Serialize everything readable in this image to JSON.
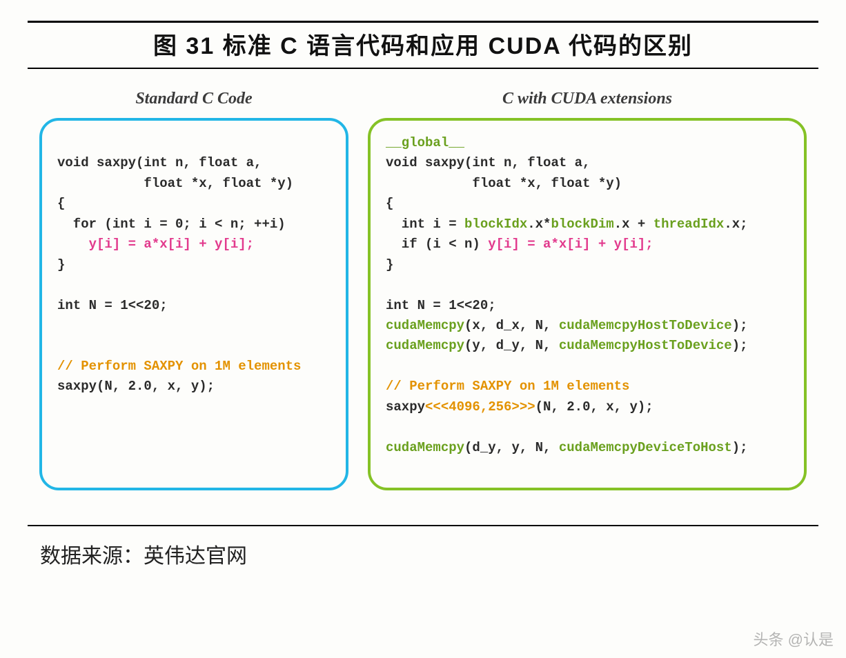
{
  "title": "图 31 标准 C 语言代码和应用 CUDA 代码的区别",
  "left": {
    "heading": "Standard C Code",
    "code": [
      {
        "text": "",
        "cls": ""
      },
      {
        "text": "void saxpy(int n, float a,",
        "cls": "tok-black"
      },
      {
        "text": "           float *x, float *y)",
        "cls": "tok-black"
      },
      {
        "text": "{",
        "cls": "tok-black"
      },
      {
        "text": "  for (int i = 0; i < n; ++i)",
        "cls": "tok-black"
      },
      {
        "text": "    y[i] = a*x[i] + y[i];",
        "cls": "tok-pink"
      },
      {
        "text": "}",
        "cls": "tok-black"
      },
      {
        "text": "",
        "cls": ""
      },
      {
        "text": "int N = 1<<20;",
        "cls": "tok-black"
      },
      {
        "text": "",
        "cls": ""
      },
      {
        "text": "",
        "cls": ""
      },
      {
        "text": "// Perform SAXPY on 1M elements",
        "cls": "tok-comment"
      },
      {
        "text": "saxpy(N, 2.0, x, y);",
        "cls": "tok-black"
      }
    ]
  },
  "right": {
    "heading": "C with CUDA extensions",
    "code": [
      {
        "segments": [
          {
            "text": "__global__",
            "cls": "tok-green"
          }
        ]
      },
      {
        "segments": [
          {
            "text": "void saxpy(int n, float a,",
            "cls": "tok-black"
          }
        ]
      },
      {
        "segments": [
          {
            "text": "           float *x, float *y)",
            "cls": "tok-black"
          }
        ]
      },
      {
        "segments": [
          {
            "text": "{",
            "cls": "tok-black"
          }
        ]
      },
      {
        "segments": [
          {
            "text": "  int i = ",
            "cls": "tok-black"
          },
          {
            "text": "blockIdx",
            "cls": "tok-green"
          },
          {
            "text": ".x*",
            "cls": "tok-black"
          },
          {
            "text": "blockDim",
            "cls": "tok-green"
          },
          {
            "text": ".x + ",
            "cls": "tok-black"
          },
          {
            "text": "threadIdx",
            "cls": "tok-green"
          },
          {
            "text": ".x;",
            "cls": "tok-black"
          }
        ]
      },
      {
        "segments": [
          {
            "text": "  if (i < n) ",
            "cls": "tok-black"
          },
          {
            "text": "y[i] = a*x[i] + y[i];",
            "cls": "tok-pink"
          }
        ]
      },
      {
        "segments": [
          {
            "text": "}",
            "cls": "tok-black"
          }
        ]
      },
      {
        "segments": [
          {
            "text": "",
            "cls": ""
          }
        ]
      },
      {
        "segments": [
          {
            "text": "int N = 1<<20;",
            "cls": "tok-black"
          }
        ]
      },
      {
        "segments": [
          {
            "text": "cudaMemcpy",
            "cls": "tok-green"
          },
          {
            "text": "(x, d_x, N, ",
            "cls": "tok-black"
          },
          {
            "text": "cudaMemcpyHostToDevice",
            "cls": "tok-green"
          },
          {
            "text": ");",
            "cls": "tok-black"
          }
        ]
      },
      {
        "segments": [
          {
            "text": "cudaMemcpy",
            "cls": "tok-green"
          },
          {
            "text": "(y, d_y, N, ",
            "cls": "tok-black"
          },
          {
            "text": "cudaMemcpyHostToDevice",
            "cls": "tok-green"
          },
          {
            "text": ");",
            "cls": "tok-black"
          }
        ]
      },
      {
        "segments": [
          {
            "text": "",
            "cls": ""
          }
        ]
      },
      {
        "segments": [
          {
            "text": "// Perform SAXPY on 1M elements",
            "cls": "tok-comment"
          }
        ]
      },
      {
        "segments": [
          {
            "text": "saxpy",
            "cls": "tok-black"
          },
          {
            "text": "<<<4096,256>>>",
            "cls": "tok-orange"
          },
          {
            "text": "(N, 2.0, x, y);",
            "cls": "tok-black"
          }
        ]
      },
      {
        "segments": [
          {
            "text": "",
            "cls": ""
          }
        ]
      },
      {
        "segments": [
          {
            "text": "cudaMemcpy",
            "cls": "tok-green"
          },
          {
            "text": "(d_y, y, N, ",
            "cls": "tok-black"
          },
          {
            "text": "cudaMemcpyDeviceToHost",
            "cls": "tok-green"
          },
          {
            "text": ");",
            "cls": "tok-black"
          }
        ]
      }
    ]
  },
  "source_label": "数据来源：英伟达官网",
  "watermark": "头条 @认是"
}
